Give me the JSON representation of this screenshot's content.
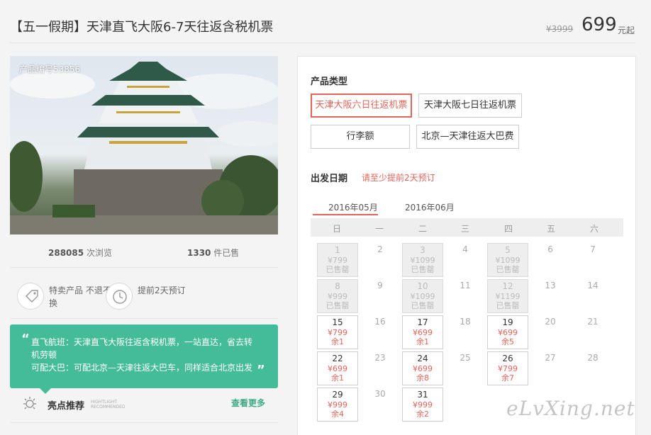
{
  "header": {
    "title": "【五一假期】天津直飞大阪6-7天往返含税机票",
    "price_original": "¥3999",
    "price_current": "699",
    "price_unit": "元起"
  },
  "product": {
    "number_label": "产品编号53856",
    "views_count": "288085",
    "views_label": "次浏览",
    "sold_count": "1330",
    "sold_label": "件已售"
  },
  "features": [
    {
      "icon": "tag-icon",
      "text": "特卖产品 不退不换"
    },
    {
      "icon": "clock-icon",
      "text": "提前2天预订"
    }
  ],
  "note": {
    "line1": "直飞航班：天津直飞大阪往返含税机票，一站直达，省去转机劳顿",
    "line2": "可配大巴：可配北京—天津往返大巴车，同样适合北京出发"
  },
  "highlights": {
    "title": "亮点推荐",
    "subtitle_en_1": "HIGHTLIGHT",
    "subtitle_en_2": "RECOMMENDED",
    "more_label": "查看更多",
    "icon": "sun-icon"
  },
  "booking": {
    "product_type_title": "产品类型",
    "options": [
      "天津大阪六日往返机票",
      "天津大阪七日往返机票",
      "行李额",
      "北京—天津往返大巴费"
    ],
    "selected_option": "天津大阪六日往返机票",
    "date_title": "出发日期",
    "date_hint": "请至少提前2天预订",
    "months": [
      "2016年05月",
      "2016年06月"
    ],
    "weekdays": [
      "日",
      "一",
      "二",
      "三",
      "四",
      "五",
      "六"
    ],
    "days": [
      {
        "d": "1",
        "price": "¥799",
        "status": "已售罄",
        "state": "sold"
      },
      {
        "d": "2",
        "state": "empty"
      },
      {
        "d": "3",
        "price": "¥1099",
        "status": "已售罄",
        "state": "sold"
      },
      {
        "d": "4",
        "state": "empty"
      },
      {
        "d": "5",
        "price": "¥1099",
        "status": "已售罄",
        "state": "sold"
      },
      {
        "d": "6",
        "state": "empty"
      },
      {
        "d": "7",
        "state": "empty"
      },
      {
        "d": "8",
        "price": "¥999",
        "status": "已售罄",
        "state": "sold"
      },
      {
        "d": "9",
        "state": "empty"
      },
      {
        "d": "10",
        "price": "¥1099",
        "status": "已售罄",
        "state": "sold"
      },
      {
        "d": "11",
        "state": "empty"
      },
      {
        "d": "12",
        "price": "¥1199",
        "status": "已售罄",
        "state": "sold"
      },
      {
        "d": "13",
        "state": "empty"
      },
      {
        "d": "14",
        "state": "empty"
      },
      {
        "d": "15",
        "price": "¥799",
        "status": "余1",
        "state": "avail"
      },
      {
        "d": "16",
        "state": "empty"
      },
      {
        "d": "17",
        "price": "¥699",
        "status": "余1",
        "state": "avail"
      },
      {
        "d": "18",
        "state": "empty"
      },
      {
        "d": "19",
        "price": "¥699",
        "status": "余5",
        "state": "avail"
      },
      {
        "d": "20",
        "state": "empty"
      },
      {
        "d": "21",
        "state": "empty"
      },
      {
        "d": "22",
        "price": "¥699",
        "status": "余1",
        "state": "avail"
      },
      {
        "d": "23",
        "state": "empty"
      },
      {
        "d": "24",
        "price": "¥699",
        "status": "余8",
        "state": "avail"
      },
      {
        "d": "25",
        "state": "empty"
      },
      {
        "d": "26",
        "price": "¥799",
        "status": "余7",
        "state": "avail"
      },
      {
        "d": "27",
        "state": "empty"
      },
      {
        "d": "28",
        "state": "empty"
      },
      {
        "d": "29",
        "price": "¥999",
        "status": "余4",
        "state": "avail"
      },
      {
        "d": "30",
        "state": "empty"
      },
      {
        "d": "31",
        "price": "¥999",
        "status": "余2",
        "state": "avail"
      }
    ]
  },
  "watermark": "eLvXing.net",
  "colors": {
    "accent": "#e4645a",
    "note_bg": "#45bc99",
    "more_link": "#3eaa85"
  }
}
